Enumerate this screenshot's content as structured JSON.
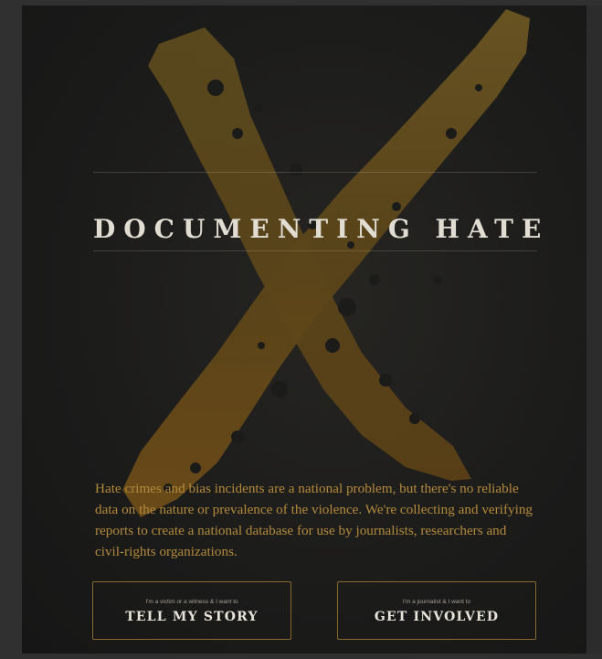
{
  "page": {
    "title": "DOCUMENTING HATE",
    "intro": "Hate crimes and bias incidents are a national problem, but there's no reliable data on the nature or prevalence of the violence. We're collecting and verifying reports to create a national database for use by journalists, researchers and civil-rights organizations."
  },
  "actions": {
    "story": {
      "small": "I'm a victim or a witness & I want to",
      "label": "TELL MY STORY"
    },
    "involved": {
      "small": "I'm a journalist & I want to",
      "label": "GET INVOLVED"
    }
  },
  "colors": {
    "background": "#1b1b1a",
    "accent": "#b38a3c",
    "brush": "#6b5220",
    "title": "#e2ddd2"
  },
  "icons": {
    "hero_mark": "brushstroke-x-icon"
  }
}
